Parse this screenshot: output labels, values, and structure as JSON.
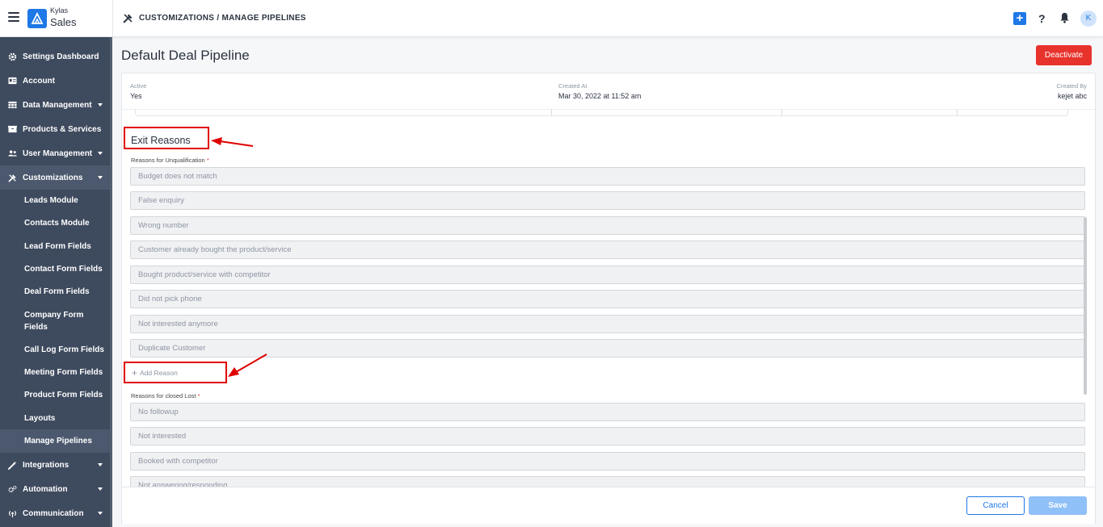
{
  "app": {
    "brand_top": "Kylas",
    "brand_bottom": "Sales",
    "breadcrumb": "CUSTOMIZATIONS / MANAGE PIPELINES",
    "help_glyph": "?",
    "avatar_initial": "K"
  },
  "icons": {
    "menu": "hamburger-icon",
    "brand": "kylas-logo",
    "breadcrumb": "tools-icon",
    "add": "plus-square-icon",
    "help": "question-icon",
    "bell": "bell-icon",
    "add_reason": "plus-icon"
  },
  "colors": {
    "sidebar_bg": "#3e4a5e",
    "accent": "#1e78e6",
    "danger": "#e8332d",
    "annotation": "#e00000"
  },
  "sidebar": {
    "items": [
      {
        "label": "Settings Dashboard",
        "icon": "gear-icon"
      },
      {
        "label": "Account",
        "icon": "id-card-icon"
      },
      {
        "label": "Data Management",
        "icon": "table-icon",
        "expandable": true
      },
      {
        "label": "Products & Services",
        "icon": "box-icon"
      },
      {
        "label": "User Management",
        "icon": "users-icon",
        "expandable": true
      },
      {
        "label": "Customizations",
        "icon": "tools-icon",
        "expandable": true,
        "expanded": true
      },
      {
        "label": "Integrations",
        "icon": "magic-wand-icon",
        "expandable": true
      },
      {
        "label": "Automation",
        "icon": "cogs-icon",
        "expandable": true
      },
      {
        "label": "Communication",
        "icon": "broadcast-icon",
        "expandable": true
      }
    ],
    "customizations_children": [
      "Leads Module",
      "Contacts Module",
      "Lead Form Fields",
      "Contact Form Fields",
      "Deal Form Fields",
      "Company Form Fields",
      "Call Log Form Fields",
      "Meeting Form Fields",
      "Product Form Fields",
      "Layouts",
      "Manage Pipelines"
    ],
    "active_child": "Manage Pipelines"
  },
  "page": {
    "title": "Default Deal Pipeline",
    "deactivate_label": "Deactivate",
    "meta": {
      "active_label": "Active",
      "active_value": "Yes",
      "created_at_label": "Created At",
      "created_at_value": "Mar 30, 2022 at 11:52 am",
      "created_by_label": "Created By",
      "created_by_value": "kejet abc"
    },
    "exit_reasons": {
      "heading": "Exit Reasons",
      "unqualification_label": "Reasons for Unqualification",
      "unqualification": [
        "Budget does not match",
        "False enquiry",
        "Wrong number",
        "Customer already bought the product/service",
        "Bought product/service with competitor",
        "Did not pick phone",
        "Not interested anymore",
        "Duplicate Customer"
      ],
      "add_reason_label": "Add Reason",
      "closed_lost_label": "Reasons for closed Lost",
      "closed_lost": [
        "No followup",
        "Not interested",
        "Booked with competitor",
        "Not answering/responding"
      ],
      "required_mark": "*"
    },
    "footer": {
      "cancel_label": "Cancel",
      "save_label": "Save"
    }
  }
}
